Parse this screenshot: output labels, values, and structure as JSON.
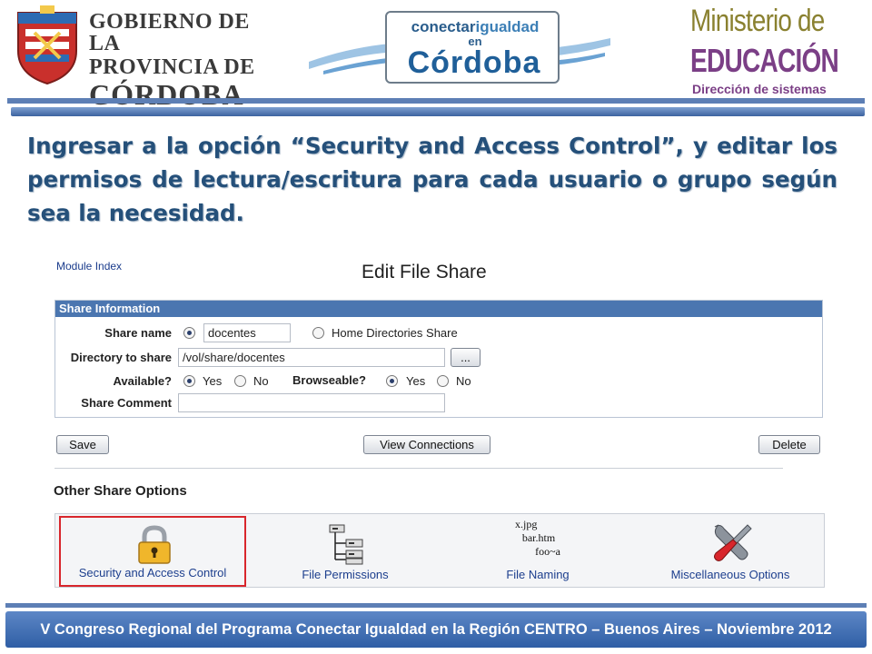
{
  "header": {
    "gov_logo": {
      "line1": "GOBIERNO DE LA",
      "line2": "PROVINCIA DE",
      "line3": "CÓRDOBA"
    },
    "cig_logo": {
      "line1a": "conectar",
      "line1b": "igualdad",
      "line2": "en",
      "line3": "Córdoba"
    },
    "ministry_logo": {
      "line1": "Ministerio de",
      "line2": "EDUCACIÓN",
      "line3": "Dirección de sistemas"
    }
  },
  "instruction": "Ingresar a la opción “Security and Access Control”, y editar los permisos de lectura/escritura para cada usuario o grupo según sea la necesidad.",
  "webmin": {
    "module_index": "Module Index",
    "page_title": "Edit File Share",
    "share_info": {
      "heading": "Share Information",
      "share_name_label": "Share name",
      "share_name_value": "docentes",
      "home_dirs_label": "Home Directories Share",
      "directory_label": "Directory to share",
      "directory_value": "/vol/share/docentes",
      "browse_button": "...",
      "available_label": "Available?",
      "browseable_label": "Browseable?",
      "yes": "Yes",
      "no": "No",
      "comment_label": "Share Comment",
      "comment_value": ""
    },
    "buttons": {
      "save": "Save",
      "view_connections": "View Connections",
      "delete": "Delete"
    },
    "other_options": {
      "title": "Other Share Options",
      "items": [
        {
          "label": "Security and Access Control",
          "icon": "padlock-icon",
          "selected": true
        },
        {
          "label": "File Permissions",
          "icon": "file-tree-icon"
        },
        {
          "label": "File Naming",
          "icon": "file-naming-icon"
        },
        {
          "label": "Miscellaneous Options",
          "icon": "tools-icon"
        }
      ],
      "file_naming_icon_text": {
        "l1": "x.jpg",
        "l2": "bar.htm",
        "l3": "foo~a"
      }
    }
  },
  "footer": "V Congreso Regional del Programa Conectar Igualdad en la Región CENTRO – Buenos Aires – Noviembre 2012",
  "colors": {
    "accent": "#4b76b0",
    "title": "#25507a",
    "selected_border": "#d8262c",
    "link": "#1d3f8e"
  }
}
